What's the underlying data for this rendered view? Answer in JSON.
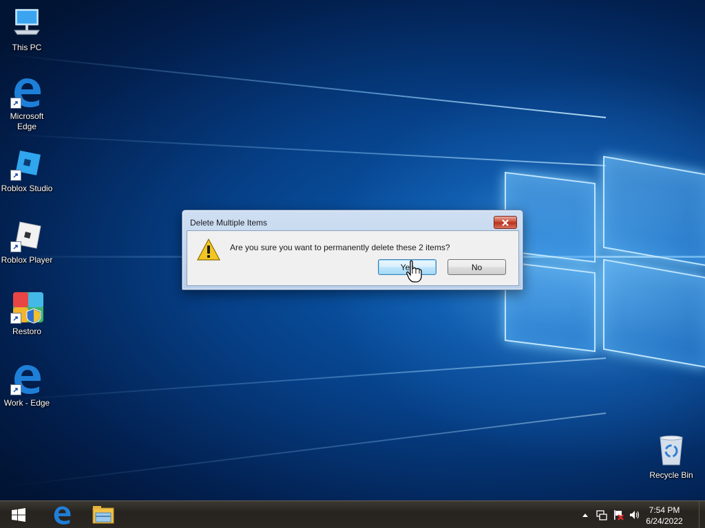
{
  "desktop_icons": [
    {
      "label": "This PC",
      "icon": "this-pc-icon"
    },
    {
      "label": "Microsoft Edge",
      "icon": "edge-icon"
    },
    {
      "label": "Roblox Studio",
      "icon": "roblox-studio-icon"
    },
    {
      "label": "Roblox Player",
      "icon": "roblox-player-icon"
    },
    {
      "label": "Restoro",
      "icon": "restoro-icon"
    },
    {
      "label": "Work - Edge",
      "icon": "edge-icon"
    },
    {
      "label": "Recycle Bin",
      "icon": "recycle-bin-icon"
    }
  ],
  "dialog": {
    "title": "Delete Multiple Items",
    "message": "Are you sure you want to permanently delete these 2 items?",
    "yes_label": "Yes",
    "no_label": "No",
    "icon": "warning-icon"
  },
  "taskbar": {
    "start_icon": "windows-start-icon",
    "pinned": [
      "edge-icon",
      "file-explorer-icon"
    ],
    "tray_icons": [
      "chevron-up-icon",
      "network-icon",
      "action-center-flag-icon",
      "volume-icon"
    ],
    "time": "7:54 PM",
    "date": "6/24/2022"
  },
  "colors": {
    "desktop_blue": "#063f86",
    "dialog_frame": "#b9d0ec",
    "taskbar": "#27231f"
  }
}
